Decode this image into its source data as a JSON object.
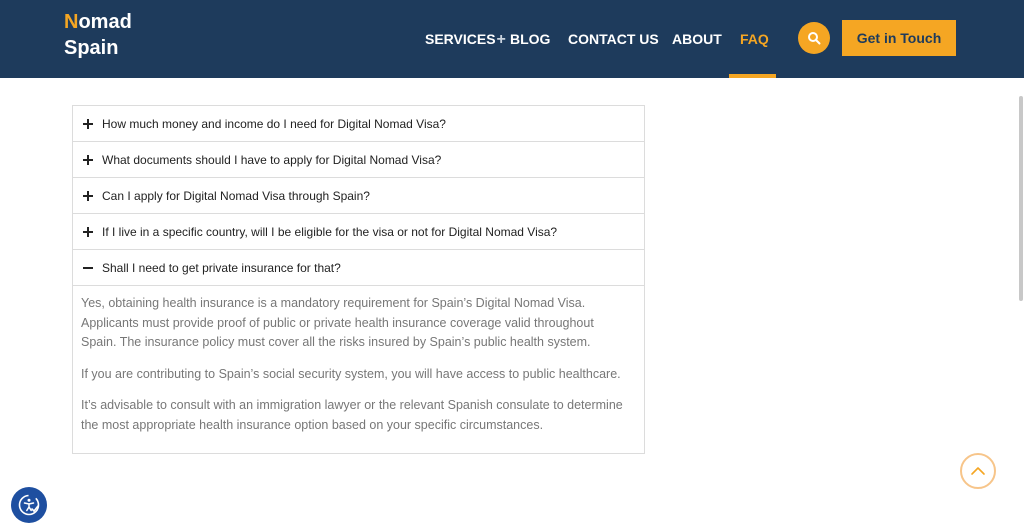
{
  "header": {
    "logo": {
      "first_letter": "N",
      "rest_first_line": "omad",
      "second_line": "Spain"
    },
    "nav": [
      {
        "label": "SERVICES",
        "has_plus": true,
        "plus": "+"
      },
      {
        "label": "BLOG"
      },
      {
        "label": "CONTACT US"
      },
      {
        "label": "ABOUT"
      },
      {
        "label": "FAQ",
        "active": true
      }
    ],
    "search_icon": "search-icon",
    "cta_label": "Get in Touch"
  },
  "faq": {
    "items": [
      {
        "question": "How much money and income do I need for Digital Nomad Visa?",
        "state": "collapsed"
      },
      {
        "question": "What documents should I have to apply for Digital Nomad Visa?",
        "state": "collapsed"
      },
      {
        "question": "Can I apply for Digital Nomad Visa through Spain?",
        "state": "collapsed"
      },
      {
        "question": "If I live in a specific country, will I be eligible for the visa or not for Digital Nomad Visa?",
        "state": "collapsed"
      },
      {
        "question": "Shall I need to get private insurance for that?",
        "state": "expanded",
        "answer": [
          "Yes, obtaining health insurance is a mandatory requirement for Spain’s Digital Nomad Visa. Applicants must provide proof of public or private health insurance coverage valid throughout Spain. The insurance policy must cover all the risks insured by Spain’s public health system.",
          "If you are contributing to Spain’s social security system, you will have access to public healthcare.",
          "It’s advisable to consult with an immigration lawyer or the relevant Spanish consulate to determine the most appropriate health insurance option based on your specific circumstances."
        ]
      }
    ]
  },
  "icons": {
    "scroll_top": "chevron-up-icon",
    "accessibility": "accessibility-icon",
    "expand": "plus-icon",
    "collapse": "minus-icon"
  },
  "colors": {
    "header_bg": "#1e3b5c",
    "accent": "#f5a623",
    "text_dark": "#222222",
    "text_muted": "#777777"
  }
}
